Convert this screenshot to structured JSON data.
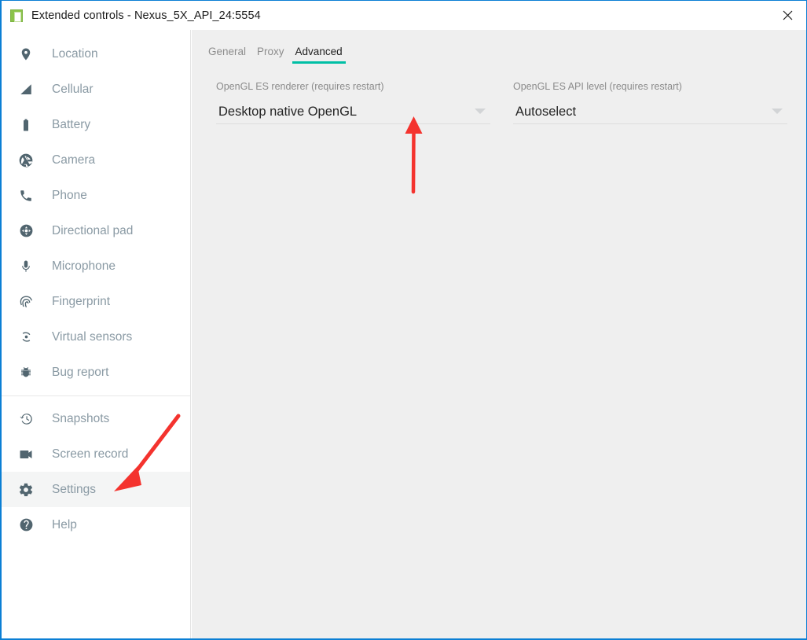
{
  "window": {
    "title": "Extended controls - Nexus_5X_API_24:5554",
    "app_icon": "android-emulator-icon",
    "close_label": "close-icon",
    "border_color": "#0b7fd4"
  },
  "sidebar": {
    "groups": [
      {
        "items": [
          {
            "label": "Location",
            "icon": "location-pin-icon",
            "active": false
          },
          {
            "label": "Cellular",
            "icon": "cellular-signal-icon",
            "active": false
          },
          {
            "label": "Battery",
            "icon": "battery-icon",
            "active": false
          },
          {
            "label": "Camera",
            "icon": "camera-aperture-icon",
            "active": false
          },
          {
            "label": "Phone",
            "icon": "phone-handset-icon",
            "active": false
          },
          {
            "label": "Directional pad",
            "icon": "directional-pad-icon",
            "active": false
          },
          {
            "label": "Microphone",
            "icon": "microphone-icon",
            "active": false
          },
          {
            "label": "Fingerprint",
            "icon": "fingerprint-icon",
            "active": false
          },
          {
            "label": "Virtual sensors",
            "icon": "virtual-sensors-icon",
            "active": false
          },
          {
            "label": "Bug report",
            "icon": "bug-icon",
            "active": false
          }
        ]
      },
      {
        "items": [
          {
            "label": "Snapshots",
            "icon": "history-clock-icon",
            "active": false
          },
          {
            "label": "Screen record",
            "icon": "video-camera-icon",
            "active": false
          },
          {
            "label": "Settings",
            "icon": "gear-icon",
            "active": true
          },
          {
            "label": "Help",
            "icon": "question-mark-circle-icon",
            "active": false
          }
        ]
      }
    ],
    "label_color": "#8a9aa4",
    "icon_color": "#51656f",
    "active_background": "#f4f5f5"
  },
  "main": {
    "tabs": [
      {
        "label": "General",
        "active": false
      },
      {
        "label": "Proxy",
        "active": false
      },
      {
        "label": "Advanced",
        "active": true
      }
    ],
    "tab_accent_color": "#00bfa5",
    "fields": [
      {
        "label": "OpenGL ES renderer (requires restart)",
        "value": "Desktop native OpenGL",
        "arrow": "chevron-down-icon"
      },
      {
        "label": "OpenGL ES API level (requires restart)",
        "value": "Autoselect",
        "arrow": "chevron-down-icon"
      }
    ],
    "background": "#efefef"
  },
  "annotations": {
    "color": "#f4332e",
    "arrows": [
      {
        "name": "arrow-pointing-to-renderer-dropdown",
        "direction": "up"
      },
      {
        "name": "arrow-pointing-to-settings-item",
        "direction": "down-left"
      }
    ]
  }
}
